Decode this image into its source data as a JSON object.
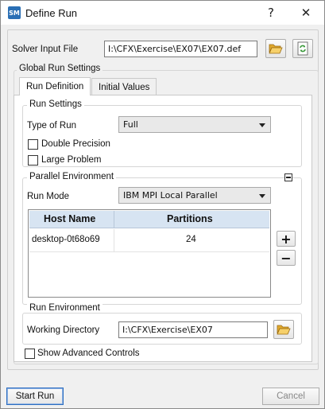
{
  "window": {
    "app_icon_label": "SM",
    "title": "Define Run",
    "help_glyph": "?",
    "close_glyph": "✕"
  },
  "solver_input": {
    "label": "Solver Input File",
    "value": "I:\\CFX\\Exercise\\EX07\\EX07.def"
  },
  "global_settings": {
    "title": "Global Run Settings",
    "tabs": [
      {
        "label": "Run Definition",
        "active": true
      },
      {
        "label": "Initial Values",
        "active": false
      }
    ]
  },
  "run_settings": {
    "title": "Run Settings",
    "type_of_run_label": "Type of Run",
    "type_of_run_value": "Full",
    "double_precision_label": "Double Precision",
    "double_precision_checked": false,
    "large_problem_label": "Large Problem",
    "large_problem_checked": false
  },
  "parallel": {
    "title": "Parallel Environment",
    "run_mode_label": "Run Mode",
    "run_mode_value": "IBM MPI Local Parallel",
    "columns": [
      "Host Name",
      "Partitions"
    ],
    "rows": [
      {
        "host": "desktop-0t68o69",
        "partitions": "24"
      }
    ],
    "add_glyph": "+",
    "remove_glyph": "−"
  },
  "run_environment": {
    "title": "Run Environment",
    "working_dir_label": "Working Directory",
    "working_dir_value": "I:\\CFX\\Exercise\\EX07"
  },
  "advanced": {
    "label": "Show Advanced Controls",
    "checked": false
  },
  "footer": {
    "start_run_label": "Start Run",
    "cancel_label": "Cancel"
  },
  "colors": {
    "grid_header": "#d7e4f2",
    "folder_icon": "#f2c14e",
    "refresh_icon": "#3a9a3a",
    "app_icon": "#2a6fb5"
  }
}
